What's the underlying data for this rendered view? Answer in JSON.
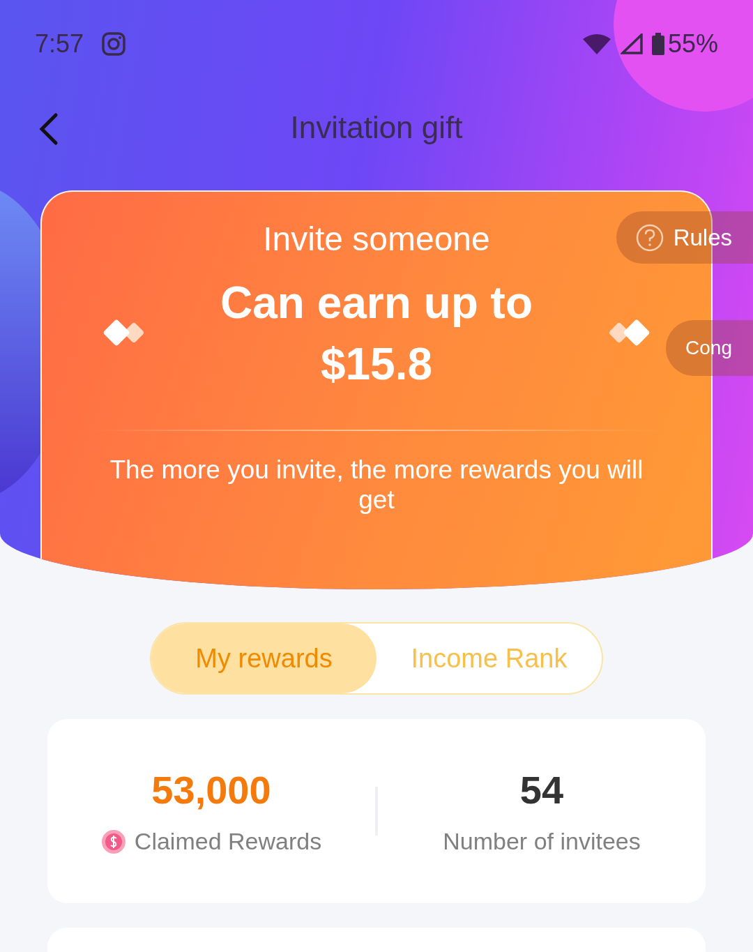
{
  "status_bar": {
    "time": "7:57",
    "battery": "55%"
  },
  "header": {
    "title": "Invitation gift"
  },
  "hero": {
    "subtitle": "Invite someone",
    "headline": "Can earn up to",
    "amount": "$15.8",
    "note": "The more you invite, the more rewards you will get"
  },
  "rules_button": {
    "label": "Rules"
  },
  "side_button": {
    "label": "Cong"
  },
  "tabs": [
    {
      "label": "My rewards",
      "selected": true
    },
    {
      "label": "Income Rank",
      "selected": false
    }
  ],
  "stats": [
    {
      "kind": "rewards",
      "value": "53,000",
      "label": "Claimed Rewards"
    },
    {
      "kind": "count",
      "value": "54",
      "label": "Number of invitees"
    }
  ]
}
